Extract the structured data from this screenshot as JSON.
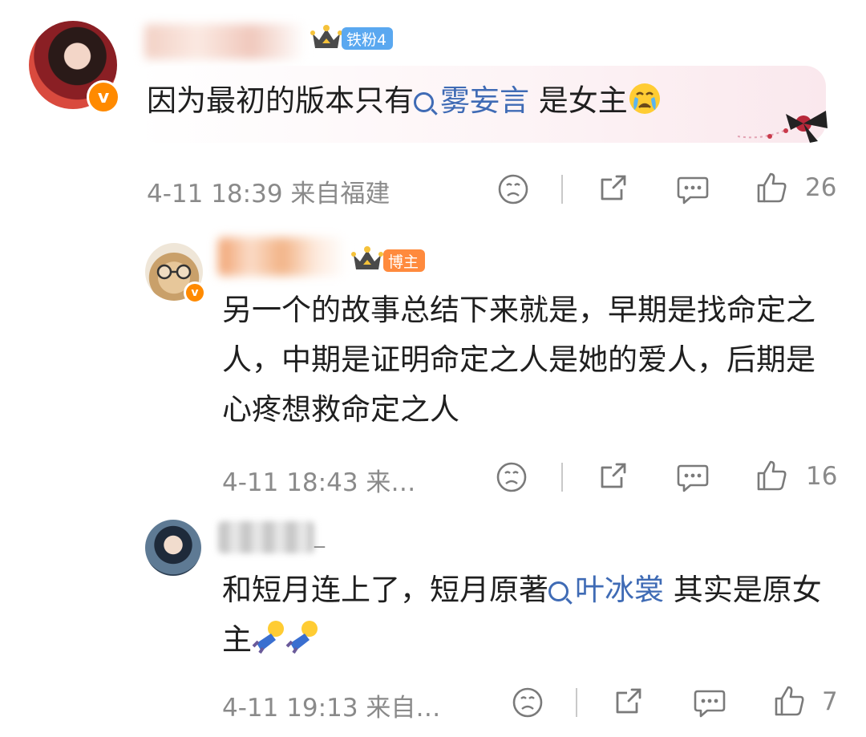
{
  "comments": [
    {
      "badge": "铁粉4",
      "text_before": "因为最初的版本只有",
      "topic": "雾妄言",
      "text_after": " 是女主",
      "time": "4-11 18:39 来自福建",
      "likes": "26",
      "emoji": "crying-face"
    },
    {
      "badge": "博主",
      "text": "另一个的故事总结下来就是，早期是找命定之人，中期是证明命定之人是她的爱人，后期是心疼想救命定之人",
      "time": "4-11 18:43 来…",
      "likes": "16"
    },
    {
      "name_suffix": "_",
      "text_before": "和短月连上了，短月原著",
      "topic": "叶冰裳",
      "text_after": " 其实是原女主",
      "time": "4-11 19:13 来自…",
      "likes": "7",
      "emoji": "falling-figure"
    }
  ],
  "colors": {
    "accent_topic": "#3f6bb5",
    "meta_gray": "#8a8a8a",
    "badge_fan": "#5aa8f0",
    "badge_host": "#ff8a3d",
    "verified": "#ff8a00"
  }
}
